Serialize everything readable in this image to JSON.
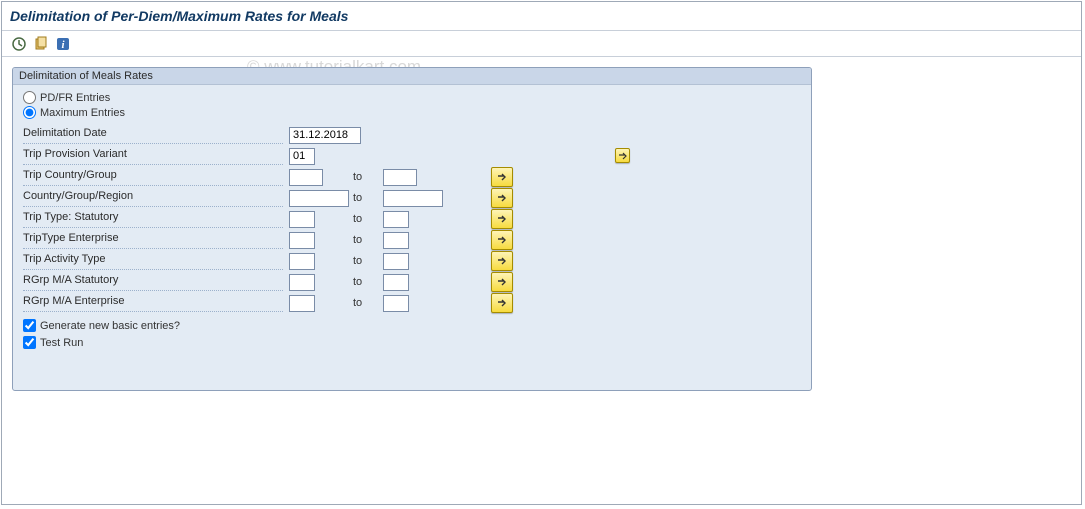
{
  "title": "Delimitation of Per-Diem/Maximum Rates for Meals",
  "watermark": "© www.tutorialkart.com",
  "toolbar": {
    "icon1": "execute-icon",
    "icon2": "variants-icon",
    "icon3": "info-icon"
  },
  "group": {
    "title": "Delimitation of Meals Rates",
    "radio_pdfr": "PD/FR Entries",
    "radio_max": "Maximum Entries",
    "radio_selected": "maximum",
    "rows": {
      "delim_date": {
        "label": "Delimitation Date",
        "value": "31.12.2018"
      },
      "trip_variant": {
        "label": "Trip Provision Variant",
        "from": "01",
        "to": ""
      },
      "trip_country": {
        "label": "Trip Country/Group",
        "from": "",
        "to": ""
      },
      "country_region": {
        "label": "Country/Group/Region",
        "from": "",
        "to": ""
      },
      "trip_type_stat": {
        "label": "Trip Type: Statutory",
        "from": "",
        "to": ""
      },
      "trip_type_ent": {
        "label": "TripType Enterprise",
        "from": "",
        "to": ""
      },
      "trip_activity": {
        "label": "Trip Activity Type",
        "from": "",
        "to": ""
      },
      "rgrp_stat": {
        "label": "RGrp M/A Statutory",
        "from": "",
        "to": ""
      },
      "rgrp_ent": {
        "label": "RGrp M/A Enterprise",
        "from": "",
        "to": ""
      }
    },
    "to_label": "to",
    "checkboxes": {
      "gen_entries": {
        "label": "Generate new basic entries?",
        "checked": true
      },
      "test_run": {
        "label": "Test Run",
        "checked": true
      }
    }
  }
}
